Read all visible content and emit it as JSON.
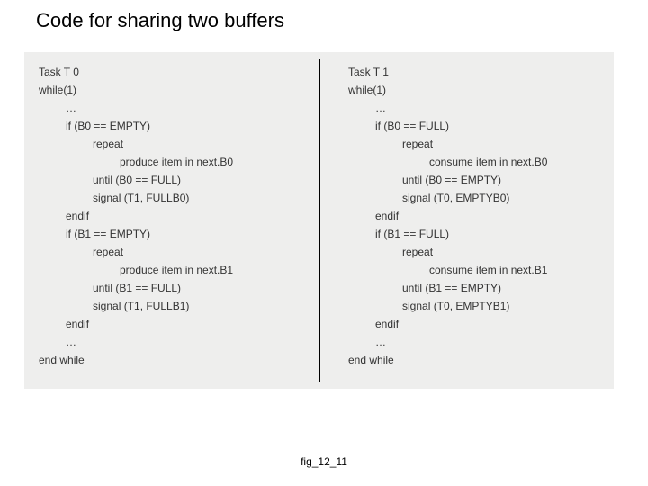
{
  "title": "Code for sharing two buffers",
  "caption": "fig_12_11",
  "left": {
    "header": "Task T 0",
    "loop": "while(1)",
    "dots1": "…",
    "if0": "if (B0 == EMPTY)",
    "rep": "repeat",
    "prod0": "produce item in next.B0",
    "until0": "until (B0 == FULL)",
    "sig0": "signal (T1, FULLB0)",
    "endif": "endif",
    "if1": "if (B1 == EMPTY)",
    "prod1": "produce item in next.B1",
    "until1": "until (B1 == FULL)",
    "sig1": "signal (T1, FULLB1)",
    "dots2": "…",
    "endwhile": "end while"
  },
  "right": {
    "header": "Task T 1",
    "loop": "while(1)",
    "dots1": "…",
    "if0": "if (B0 == FULL)",
    "rep": "repeat",
    "cons0": "consume item in next.B0",
    "until0": "until (B0 == EMPTY)",
    "sig0": "signal (T0, EMPTYB0)",
    "endif": "endif",
    "if1": "if (B1 == FULL)",
    "cons1": "consume item in next.B1",
    "until1": "until (B1 == EMPTY)",
    "sig1": "signal (T0, EMPTYB1)",
    "dots2": "…",
    "endwhile": "end while"
  }
}
